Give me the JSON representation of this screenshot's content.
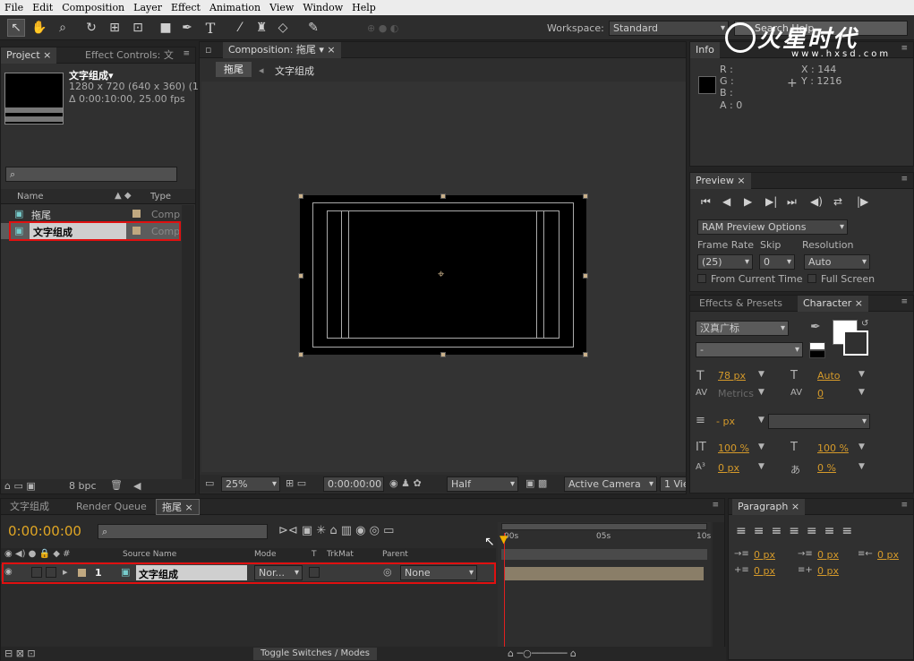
{
  "menu": [
    "File",
    "Edit",
    "Composition",
    "Layer",
    "Effect",
    "Animation",
    "View",
    "Window",
    "Help"
  ],
  "toolbar": {
    "tools": [
      {
        "name": "selection-tool",
        "glyph": "↖"
      },
      {
        "name": "hand-tool",
        "glyph": "✋"
      },
      {
        "name": "zoom-tool",
        "glyph": "⌕"
      },
      {
        "name": "rotate-tool",
        "glyph": "↻"
      },
      {
        "name": "camera-tool",
        "glyph": "⊞"
      },
      {
        "name": "pan-behind-tool",
        "glyph": "⊡"
      },
      {
        "name": "shape-tool",
        "glyph": "■"
      },
      {
        "name": "pen-tool",
        "glyph": "✒"
      },
      {
        "name": "type-tool",
        "glyph": "T"
      },
      {
        "name": "brush-tool",
        "glyph": "⁄"
      },
      {
        "name": "clone-stamp-tool",
        "glyph": "♜"
      },
      {
        "name": "eraser-tool",
        "glyph": "◇"
      },
      {
        "name": "puppet-tool",
        "glyph": "✎"
      }
    ],
    "workspace_label": "Workspace:",
    "workspace_value": "Standard",
    "search_placeholder": "Search Help"
  },
  "watermark": {
    "brand": "火星时代",
    "url": "www.hxsd.com"
  },
  "project": {
    "tab_project": "Project",
    "tab_effect_controls": "Effect Controls: 文",
    "item_name": "文字组成▾",
    "item_dims": "1280 x 720  (640 x 360) (1...",
    "item_dur": "Δ 0:00:10:00, 25.00 fps",
    "col_name": "Name",
    "col_type": "Type",
    "rows": [
      {
        "name": "拖尾",
        "type": "Comp"
      },
      {
        "name": "文字组成",
        "type": "Comp"
      }
    ],
    "bpc": "8 bpc"
  },
  "composition": {
    "tab": "Composition: 拖尾",
    "crumb1": "拖尾",
    "crumb2": "文字组成",
    "zoom": "25%",
    "timecode": "0:00:00:00",
    "resolution": "Half",
    "camera": "Active Camera",
    "view": "1 Vie"
  },
  "info": {
    "tab": "Info",
    "r": "R :",
    "g": "G :",
    "b": "B :",
    "a": "A : 0",
    "x": "X : 144",
    "y": "Y : 1216"
  },
  "preview": {
    "tab": "Preview",
    "ram_options": "RAM Preview Options",
    "frame_rate_label": "Frame Rate",
    "skip_label": "Skip",
    "resolution_label": "Resolution",
    "frame_rate": "(25)",
    "skip": "0",
    "resolution": "Auto",
    "from_current": "From Current Time",
    "full_screen": "Full Screen"
  },
  "character": {
    "tab_effects": "Effects & Presets",
    "tab_character": "Character",
    "font": "汉真广标",
    "style": "-",
    "size": "78 px",
    "leading": "Auto",
    "kerning": "Metrics",
    "tracking": "0",
    "stroke": "- px",
    "vscale": "100 %",
    "hscale": "100 %",
    "baseline": "0 px",
    "tsume": "0 %"
  },
  "paragraph": {
    "tab": "Paragraph",
    "indent_left": "0 px",
    "indent_first": "0 px",
    "indent_right": "0 px",
    "space_before": "0 px",
    "space_after": "0 px"
  },
  "timeline": {
    "tabs": [
      "文字组成",
      "Render Queue",
      "拖尾"
    ],
    "timecode": "0:00:00:00",
    "cols": {
      "source": "Source Name",
      "mode": "Mode",
      "t": "T",
      "trkmat": "TrkMat",
      "parent": "Parent"
    },
    "layer": {
      "num": "1",
      "name": "文字组成",
      "mode": "Nor...",
      "parent": "None"
    },
    "ruler": [
      "00s",
      "05s",
      "10s"
    ],
    "toggle": "Toggle Switches / Modes"
  }
}
